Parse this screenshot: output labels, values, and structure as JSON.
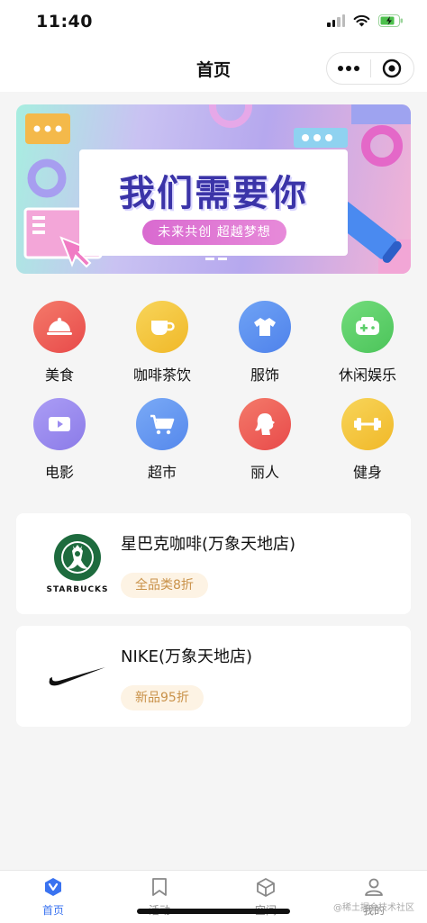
{
  "status_bar": {
    "time": "11:40"
  },
  "nav": {
    "title": "首页"
  },
  "banner": {
    "title": "我们需要你",
    "subtitle": "未来共创  超越梦想"
  },
  "categories": [
    {
      "label": "美食",
      "icon": "cloche-icon",
      "color": "#ef5350"
    },
    {
      "label": "咖啡茶饮",
      "icon": "coffee-cup-icon",
      "color": "#f3c23b"
    },
    {
      "label": "服饰",
      "icon": "tshirt-icon",
      "color": "#5c8ff0"
    },
    {
      "label": "休闲娱乐",
      "icon": "gamepad-icon",
      "color": "#5ccf6a"
    },
    {
      "label": "电影",
      "icon": "video-icon",
      "color": "#9b8cf0"
    },
    {
      "label": "超市",
      "icon": "shopping-cart-icon",
      "color": "#5c8ff0"
    },
    {
      "label": "丽人",
      "icon": "woman-profile-icon",
      "color": "#ef5350"
    },
    {
      "label": "健身",
      "icon": "dumbbell-icon",
      "color": "#f3c23b"
    }
  ],
  "stores": [
    {
      "name": "星巴克咖啡(万象天地店)",
      "tag": "全品类8折",
      "logo_text": "STARBUCKS",
      "logo_color": "#1e6b3e"
    },
    {
      "name": "NIKE(万象天地店)",
      "tag": "新品95折",
      "logo_text": ""
    }
  ],
  "tabs": [
    {
      "label": "首页",
      "icon": "home-shield-icon",
      "active": true
    },
    {
      "label": "活动",
      "icon": "bookmark-icon",
      "active": false
    },
    {
      "label": "空间",
      "icon": "cube-icon",
      "active": false
    },
    {
      "label": "我的",
      "icon": "user-icon",
      "active": false
    }
  ],
  "watermark": "@稀土掘金技术社区",
  "colors": {
    "accent": "#3a73f0",
    "tag_bg": "#fdf3e4",
    "tag_text": "#c9924a"
  }
}
